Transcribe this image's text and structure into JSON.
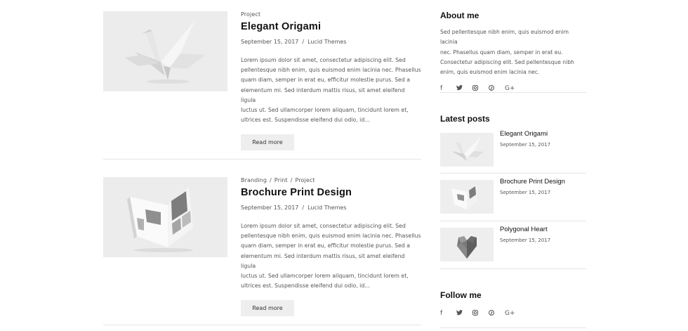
{
  "posts": [
    {
      "categories": [
        "Project"
      ],
      "title": "Elegant Origami",
      "date": "September 15, 2017",
      "author": "Lucid Themes",
      "excerpt_lines": [
        "Lorem ipsum dolor sit amet, consectetur adipiscing elit. Sed",
        "pellentesque nibh enim, quis euismod enim lacinia nec. Phasellus",
        "quam diam, semper in erat eu, efficitur molestie purus. Sed a",
        "elementum mi. Sed interdum mattis risus, sit amet eleifend ligula",
        "luctus ut. Sed ullamcorper lorem aliquam, tincidunt lorem et,",
        "ultrices est. Suspendisse eleifend dui odio, id..."
      ],
      "read_more": "Read more"
    },
    {
      "categories": [
        "Branding",
        "Print",
        "Project"
      ],
      "title": "Brochure Print Design",
      "date": "September 15, 2017",
      "author": "Lucid Themes",
      "excerpt_lines": [
        "Lorem ipsum dolor sit amet, consectetur adipiscing elit. Sed",
        "pellentesque nibh enim, quis euismod enim lacinia nec. Phasellus",
        "quam diam, semper in erat eu, efficitur molestie purus. Sed a",
        "elementum mi. Sed interdum mattis risus, sit amet eleifend ligula",
        "luctus ut. Sed ullamcorper lorem aliquam, tincidunt lorem et,",
        "ultrices est. Suspendisse eleifend dui odio, id..."
      ],
      "read_more": "Read more"
    }
  ],
  "meta_separator": "/",
  "sidebar": {
    "about": {
      "title": "About me",
      "text_lines": [
        "Sed pellentesque nibh enim, quis euismod enim lacinia",
        "nec. Phasellus quam diam, semper in erat eu.",
        "Consectetur adipiscing elit. Sed pellentesque nibh",
        "enim, quis euismod enim lacinia nec."
      ]
    },
    "socials": [
      {
        "icon": "facebook-icon",
        "glyph": "f"
      },
      {
        "icon": "twitter-icon",
        "glyph": "🐦"
      },
      {
        "icon": "instagram-icon",
        "glyph": "◎"
      },
      {
        "icon": "pinterest-icon",
        "glyph": "℗"
      },
      {
        "icon": "google-plus-icon",
        "glyph": "G+"
      }
    ],
    "latest": {
      "title": "Latest posts",
      "items": [
        {
          "title": "Elegant Origami",
          "date": "September 15, 2017"
        },
        {
          "title": "Brochure Print Design",
          "date": "September 15, 2017"
        },
        {
          "title": "Polygonal Heart",
          "date": "September 15, 2017"
        }
      ]
    },
    "follow": {
      "title": "Follow me"
    }
  },
  "colors": {
    "text": "#333333",
    "muted": "#555555",
    "divider": "#e5e5e5",
    "button_bg": "#eeeeee"
  }
}
